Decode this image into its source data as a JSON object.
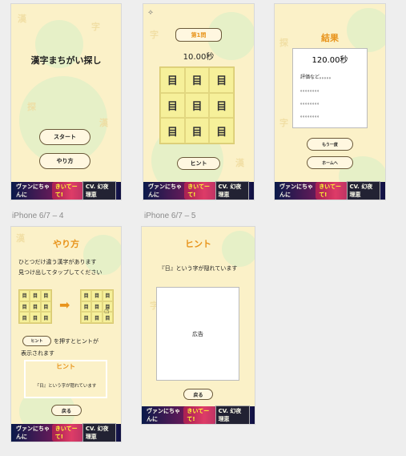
{
  "artboards": {
    "title": {
      "app_title": "漢字まちがい探し",
      "start_label": "スタート",
      "howto_label": "やり方"
    },
    "game": {
      "stage_label": "第1問",
      "timer": "10.00秒",
      "grid_char": "目",
      "hint_label": "ヒント"
    },
    "result": {
      "heading": "結果",
      "time": "120.00秒",
      "comment": "評価など。。。。。",
      "dots": "。。。。。。。。",
      "retry_label": "もう一度",
      "home_label": "ホームへ"
    },
    "howto": {
      "artboard_name": "iPhone 6/7 – 4",
      "heading": "やり方",
      "line1": "ひとつだけ違う漢字があります",
      "line2": "見つけ出してタップしてください",
      "cell_char": "目",
      "arrow": "➡",
      "hint_btn": "ヒント",
      "hint_text_a": "を押すとヒントが",
      "hint_text_b": "表示されます",
      "hint_title": "ヒント",
      "hint_body": "『日』という字が隠れています",
      "back_label": "戻る"
    },
    "hint": {
      "artboard_name": "iPhone 6/7 – 5",
      "heading": "ヒント",
      "message": "『日』という字が隠れています",
      "ad_label": "広告",
      "back_label": "戻る"
    }
  },
  "ad_banner": {
    "left": "ヴァンにちゃんに",
    "mid": "きいてーて!",
    "right": "CV. 幻夜理恵"
  },
  "colors": {
    "background": "#fbf1c8",
    "accent": "#e8941c",
    "grid": "#f6f09a"
  }
}
